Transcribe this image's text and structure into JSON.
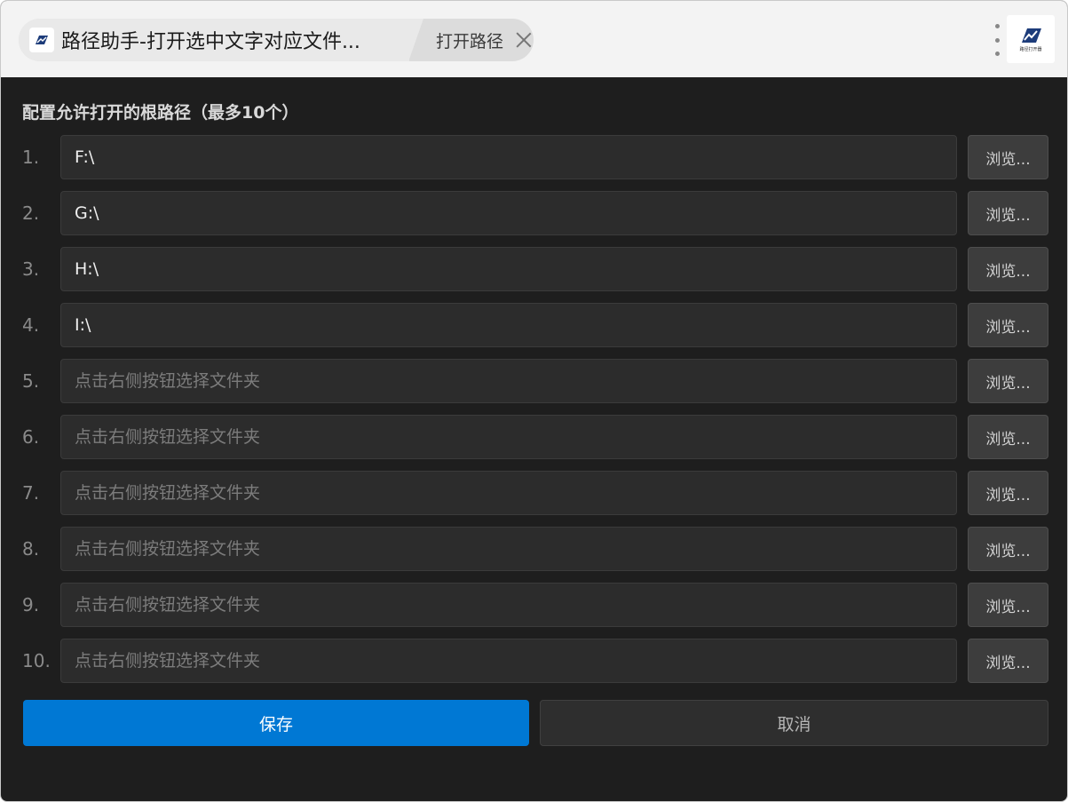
{
  "titlebar": {
    "tab_title": "路径助手-打开选中文字对应文件...",
    "secondary_tab_label": "打开路径",
    "logo_caption": "路径打开器"
  },
  "content": {
    "heading": "配置允许打开的根路径（最多10个）",
    "browse_label": "浏览...",
    "placeholder": "点击右侧按钮选择文件夹",
    "rows": [
      {
        "num": "1.",
        "value": "F:\\"
      },
      {
        "num": "2.",
        "value": "G:\\"
      },
      {
        "num": "3.",
        "value": "H:\\"
      },
      {
        "num": "4.",
        "value": "I:\\"
      },
      {
        "num": "5.",
        "value": ""
      },
      {
        "num": "6.",
        "value": ""
      },
      {
        "num": "7.",
        "value": ""
      },
      {
        "num": "8.",
        "value": ""
      },
      {
        "num": "9.",
        "value": ""
      },
      {
        "num": "10.",
        "value": ""
      }
    ]
  },
  "actions": {
    "save_label": "保存",
    "cancel_label": "取消"
  },
  "colors": {
    "accent": "#0078d4",
    "background": "#1e1e1e",
    "titlebar": "#f3f3f3"
  }
}
